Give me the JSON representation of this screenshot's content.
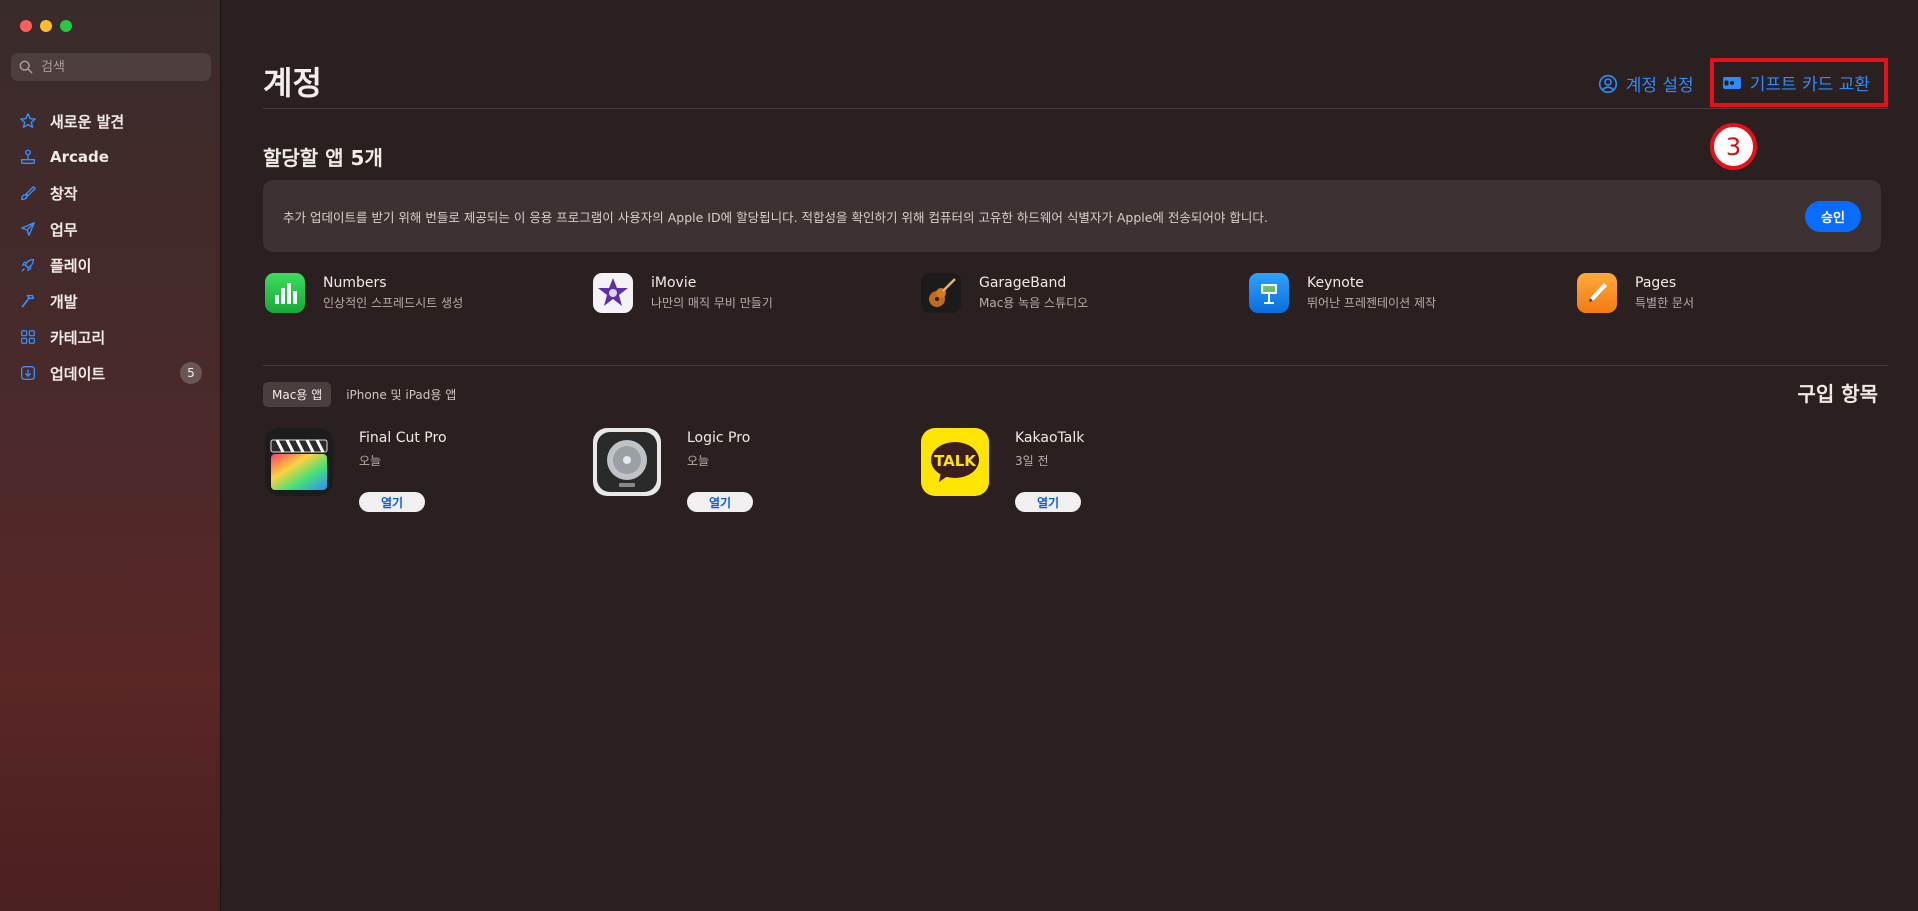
{
  "sidebar": {
    "search_placeholder": "검색",
    "items": [
      {
        "label": "새로운 발견",
        "icon": "star-icon"
      },
      {
        "label": "Arcade",
        "icon": "joystick-icon"
      },
      {
        "label": "창작",
        "icon": "brush-icon"
      },
      {
        "label": "업무",
        "icon": "paper-plane-icon"
      },
      {
        "label": "플레이",
        "icon": "rocket-icon"
      },
      {
        "label": "개발",
        "icon": "hammer-icon"
      },
      {
        "label": "카테고리",
        "icon": "grid-icon"
      },
      {
        "label": "업데이트",
        "icon": "download-icon",
        "badge": "5"
      }
    ]
  },
  "header": {
    "title": "계정",
    "account_settings": "계정 설정",
    "gift_card": "기프트 카드 교환"
  },
  "annotation": {
    "step": "3"
  },
  "assign": {
    "title": "할당할 앱 5개",
    "notice": "추가 업데이트를 받기 위해 번들로 제공되는 이 응용 프로그램이 사용자의 Apple ID에 할당됩니다. 적합성을 확인하기 위해 컴퓨터의 고유한 하드웨어 식별자가 Apple에 전송되어야 합니다.",
    "approve": "승인",
    "apps": [
      {
        "name": "Numbers",
        "subtitle": "인상적인 스프레드시트 생성"
      },
      {
        "name": "iMovie",
        "subtitle": "나만의 매직 무비 만들기"
      },
      {
        "name": "GarageBand",
        "subtitle": "Mac용 녹음 스튜디오"
      },
      {
        "name": "Keynote",
        "subtitle": "뛰어난 프레젠테이션 제작"
      },
      {
        "name": "Pages",
        "subtitle": "특별한 문서"
      }
    ]
  },
  "purchased": {
    "tab_mac": "Mac용 앱",
    "tab_iphone": "iPhone 및 iPad용 앱",
    "title": "구입 항목",
    "items": [
      {
        "name": "Final Cut Pro",
        "date": "오늘",
        "button": "열기"
      },
      {
        "name": "Logic Pro",
        "date": "오늘",
        "button": "열기"
      },
      {
        "name": "KakaoTalk",
        "date": "3일 전",
        "button": "열기"
      }
    ]
  },
  "colors": {
    "accent": "#0a6bff",
    "link": "#2e8bff",
    "highlight": "#e5101a"
  }
}
